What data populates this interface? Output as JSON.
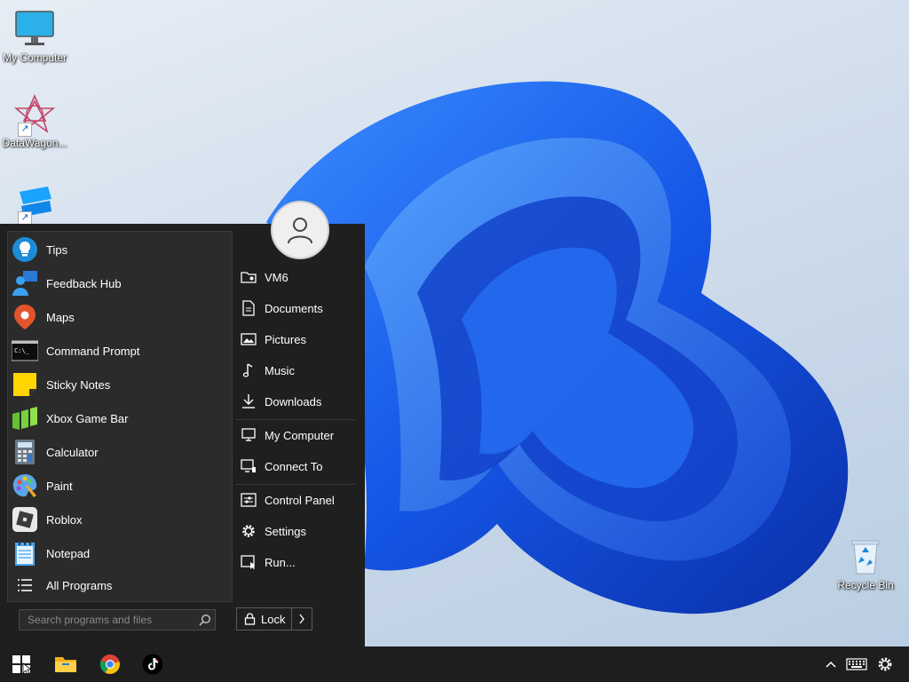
{
  "desktop": {
    "icons": [
      {
        "label": "My Computer"
      },
      {
        "label": "DataWagon..."
      },
      {
        "label": ""
      },
      {
        "label": "Recycle Bin"
      }
    ]
  },
  "start_menu": {
    "apps": [
      {
        "label": "Tips",
        "icon": "lightbulb-icon"
      },
      {
        "label": "Feedback Hub",
        "icon": "feedback-icon"
      },
      {
        "label": "Maps",
        "icon": "map-pin-icon"
      },
      {
        "label": "Command Prompt",
        "icon": "terminal-icon"
      },
      {
        "label": "Sticky Notes",
        "icon": "sticky-note-icon"
      },
      {
        "label": "Xbox Game Bar",
        "icon": "game-bar-icon"
      },
      {
        "label": "Calculator",
        "icon": "calculator-icon"
      },
      {
        "label": "Paint",
        "icon": "palette-icon"
      },
      {
        "label": "Roblox",
        "icon": "roblox-icon"
      },
      {
        "label": "Notepad",
        "icon": "notepad-icon"
      }
    ],
    "all_programs": "All Programs",
    "search_placeholder": "Search programs and files",
    "places": [
      {
        "label": "VM6",
        "icon": "user-folder-icon"
      },
      {
        "label": "Documents",
        "icon": "document-icon"
      },
      {
        "label": "Pictures",
        "icon": "picture-icon"
      },
      {
        "label": "Music",
        "icon": "music-note-icon"
      },
      {
        "label": "Downloads",
        "icon": "download-icon"
      },
      {
        "label": "My Computer",
        "icon": "computer-icon"
      },
      {
        "label": "Connect To",
        "icon": "connect-icon"
      },
      {
        "label": "Control Panel",
        "icon": "control-panel-icon"
      },
      {
        "label": "Settings",
        "icon": "gear-icon"
      },
      {
        "label": "Run...",
        "icon": "run-icon"
      }
    ],
    "lock_label": "Lock"
  },
  "taskbar": {
    "pinned": [
      "start-icon",
      "file-explorer-icon",
      "chrome-icon",
      "tiktok-icon"
    ],
    "tray": [
      "chevron-up-icon",
      "keyboard-icon",
      "gear-icon"
    ]
  },
  "colors": {
    "start_bg": "#1f1f1f",
    "taskbar_bg": "#1e1e1e",
    "accent": "#1a5fd0"
  }
}
